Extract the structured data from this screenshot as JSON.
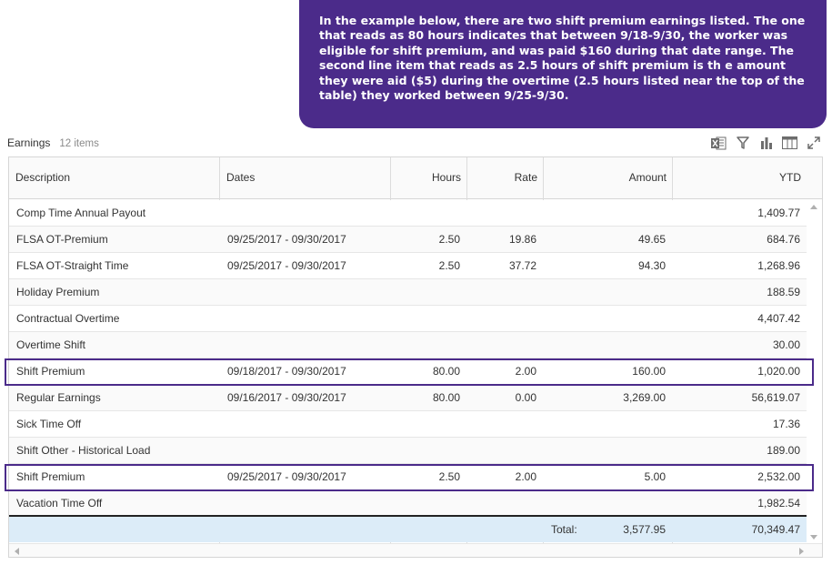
{
  "callout": {
    "text": "In the example below, there are two shift premium earnings listed. The one that reads as 80 hours indicates that between 9/18-9/30, the worker was eligible for shift premium, and was paid $160 during that date range. The second line item that reads as 2.5 hours of shift premium is th e amount they were aid ($5) during the overtime (2.5 hours listed near the top of the table) they worked between 9/25-9/30."
  },
  "earnings": {
    "title": "Earnings",
    "count": "12 items"
  },
  "toolbar": {
    "icons": [
      "excel-export-icon",
      "filter-icon",
      "chart-icon",
      "columns-icon",
      "expand-icon"
    ]
  },
  "table": {
    "columns": [
      "Description",
      "Dates",
      "Hours",
      "Rate",
      "Amount",
      "YTD"
    ],
    "rows": [
      {
        "description": "Comp Time Annual Payout",
        "dates": "",
        "hours": "",
        "rate": "",
        "amount": "",
        "ytd": "1,409.77"
      },
      {
        "description": "FLSA OT-Premium",
        "dates": "09/25/2017 - 09/30/2017",
        "hours": "2.50",
        "rate": "19.86",
        "amount": "49.65",
        "ytd": "684.76"
      },
      {
        "description": "FLSA OT-Straight Time",
        "dates": "09/25/2017 - 09/30/2017",
        "hours": "2.50",
        "rate": "37.72",
        "amount": "94.30",
        "ytd": "1,268.96"
      },
      {
        "description": "Holiday Premium",
        "dates": "",
        "hours": "",
        "rate": "",
        "amount": "",
        "ytd": "188.59"
      },
      {
        "description": "Contractual Overtime",
        "dates": "",
        "hours": "",
        "rate": "",
        "amount": "",
        "ytd": "4,407.42"
      },
      {
        "description": "Overtime Shift",
        "dates": "",
        "hours": "",
        "rate": "",
        "amount": "",
        "ytd": "30.00"
      },
      {
        "description": "Shift Premium",
        "dates": "09/18/2017 - 09/30/2017",
        "hours": "80.00",
        "rate": "2.00",
        "amount": "160.00",
        "ytd": "1,020.00"
      },
      {
        "description": "Regular Earnings",
        "dates": "09/16/2017 - 09/30/2017",
        "hours": "80.00",
        "rate": "0.00",
        "amount": "3,269.00",
        "ytd": "56,619.07"
      },
      {
        "description": "Sick Time Off",
        "dates": "",
        "hours": "",
        "rate": "",
        "amount": "",
        "ytd": "17.36"
      },
      {
        "description": "Shift Other - Historical Load",
        "dates": "",
        "hours": "",
        "rate": "",
        "amount": "",
        "ytd": "189.00"
      },
      {
        "description": "Shift Premium",
        "dates": "09/25/2017 - 09/30/2017",
        "hours": "2.50",
        "rate": "2.00",
        "amount": "5.00",
        "ytd": "2,532.00"
      },
      {
        "description": "Vacation Time Off",
        "dates": "",
        "hours": "",
        "rate": "",
        "amount": "",
        "ytd": "1,982.54"
      }
    ],
    "total": {
      "label": "Total:",
      "amount": "3,577.95",
      "ytd": "70,349.47"
    }
  },
  "colors": {
    "callout_bg": "#4b2b8a",
    "highlight_border": "#4b2b8a",
    "total_row_bg": "#dcecf8"
  }
}
